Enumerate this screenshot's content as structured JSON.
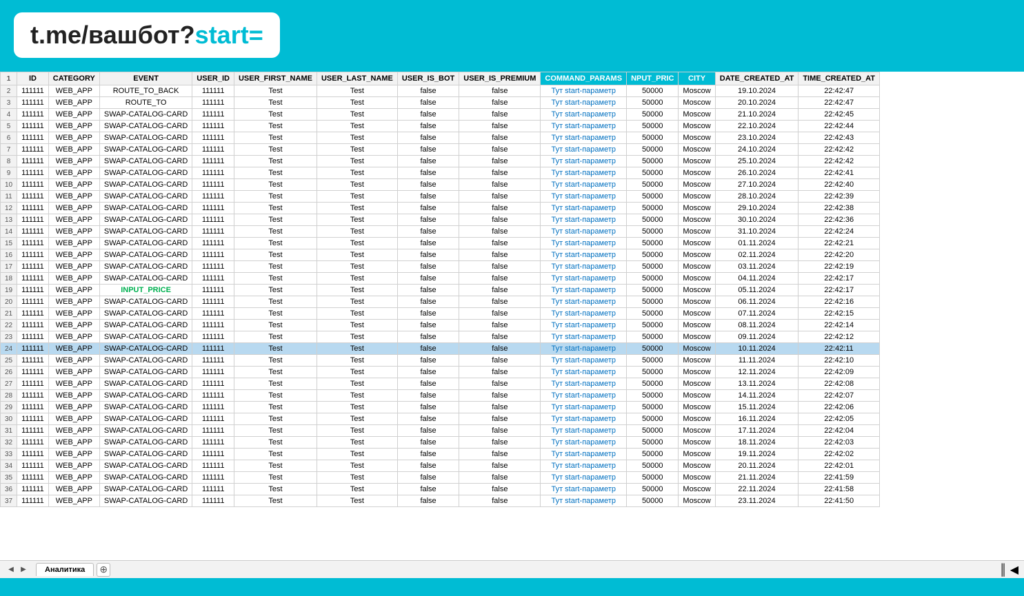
{
  "header": {
    "logo": "t.me/вашбот?start="
  },
  "table": {
    "columns": [
      {
        "key": "row_num",
        "label": "1"
      },
      {
        "key": "id",
        "label": "ID"
      },
      {
        "key": "category",
        "label": "CATEGORY"
      },
      {
        "key": "event",
        "label": "EVENT"
      },
      {
        "key": "user_id",
        "label": "USER_ID"
      },
      {
        "key": "user_first_name",
        "label": "USER_FIRST_NAME"
      },
      {
        "key": "user_last_name",
        "label": "USER_LAST_NAME"
      },
      {
        "key": "user_is_bot",
        "label": "USER_IS_BOT"
      },
      {
        "key": "user_is_premium",
        "label": "USER_IS_PREMIUM"
      },
      {
        "key": "command_params",
        "label": "COMMAND_PARAMS"
      },
      {
        "key": "input_price",
        "label": "NPUT_PRIC"
      },
      {
        "key": "city",
        "label": "CITY"
      },
      {
        "key": "date_created_at",
        "label": "DATE_CREATED_AT"
      },
      {
        "key": "time_created_at",
        "label": "TIME_CREATED_AT"
      }
    ],
    "rows": [
      {
        "row": 2,
        "id": "111111",
        "category": "WEB_APP",
        "event": "ROUTE_TO_BACK",
        "user_id": "111111",
        "fn": "Test",
        "ln": "Test",
        "bot": "false",
        "premium": "false",
        "params": "Тут start-параметр",
        "price": "50000",
        "city": "Moscow",
        "date": "19.10.2024",
        "time": "22:42:47"
      },
      {
        "row": 3,
        "id": "111111",
        "category": "WEB_APP",
        "event": "ROUTE_TO",
        "user_id": "111111",
        "fn": "Test",
        "ln": "Test",
        "bot": "false",
        "premium": "false",
        "params": "Тут start-параметр",
        "price": "50000",
        "city": "Moscow",
        "date": "20.10.2024",
        "time": "22:42:47"
      },
      {
        "row": 4,
        "id": "111111",
        "category": "WEB_APP",
        "event": "SWAP-CATALOG-CARD",
        "user_id": "111111",
        "fn": "Test",
        "ln": "Test",
        "bot": "false",
        "premium": "false",
        "params": "Тут start-параметр",
        "price": "50000",
        "city": "Moscow",
        "date": "21.10.2024",
        "time": "22:42:45"
      },
      {
        "row": 5,
        "id": "111111",
        "category": "WEB_APP",
        "event": "SWAP-CATALOG-CARD",
        "user_id": "111111",
        "fn": "Test",
        "ln": "Test",
        "bot": "false",
        "premium": "false",
        "params": "Тут start-параметр",
        "price": "50000",
        "city": "Moscow",
        "date": "22.10.2024",
        "time": "22:42:44"
      },
      {
        "row": 6,
        "id": "111111",
        "category": "WEB_APP",
        "event": "SWAP-CATALOG-CARD",
        "user_id": "111111",
        "fn": "Test",
        "ln": "Test",
        "bot": "false",
        "premium": "false",
        "params": "Тут start-параметр",
        "price": "50000",
        "city": "Moscow",
        "date": "23.10.2024",
        "time": "22:42:43"
      },
      {
        "row": 7,
        "id": "111111",
        "category": "WEB_APP",
        "event": "SWAP-CATALOG-CARD",
        "user_id": "111111",
        "fn": "Test",
        "ln": "Test",
        "bot": "false",
        "premium": "false",
        "params": "Тут start-параметр",
        "price": "50000",
        "city": "Moscow",
        "date": "24.10.2024",
        "time": "22:42:42"
      },
      {
        "row": 8,
        "id": "111111",
        "category": "WEB_APP",
        "event": "SWAP-CATALOG-CARD",
        "user_id": "111111",
        "fn": "Test",
        "ln": "Test",
        "bot": "false",
        "premium": "false",
        "params": "Тут start-параметр",
        "price": "50000",
        "city": "Moscow",
        "date": "25.10.2024",
        "time": "22:42:42"
      },
      {
        "row": 9,
        "id": "111111",
        "category": "WEB_APP",
        "event": "SWAP-CATALOG-CARD",
        "user_id": "111111",
        "fn": "Test",
        "ln": "Test",
        "bot": "false",
        "premium": "false",
        "params": "Тут start-параметр",
        "price": "50000",
        "city": "Moscow",
        "date": "26.10.2024",
        "time": "22:42:41"
      },
      {
        "row": 10,
        "id": "111111",
        "category": "WEB_APP",
        "event": "SWAP-CATALOG-CARD",
        "user_id": "111111",
        "fn": "Test",
        "ln": "Test",
        "bot": "false",
        "premium": "false",
        "params": "Тут start-параметр",
        "price": "50000",
        "city": "Moscow",
        "date": "27.10.2024",
        "time": "22:42:40"
      },
      {
        "row": 11,
        "id": "111111",
        "category": "WEB_APP",
        "event": "SWAP-CATALOG-CARD",
        "user_id": "111111",
        "fn": "Test",
        "ln": "Test",
        "bot": "false",
        "premium": "false",
        "params": "Тут start-параметр",
        "price": "50000",
        "city": "Moscow",
        "date": "28.10.2024",
        "time": "22:42:39"
      },
      {
        "row": 12,
        "id": "111111",
        "category": "WEB_APP",
        "event": "SWAP-CATALOG-CARD",
        "user_id": "111111",
        "fn": "Test",
        "ln": "Test",
        "bot": "false",
        "premium": "false",
        "params": "Тут start-параметр",
        "price": "50000",
        "city": "Moscow",
        "date": "29.10.2024",
        "time": "22:42:38"
      },
      {
        "row": 13,
        "id": "111111",
        "category": "WEB_APP",
        "event": "SWAP-CATALOG-CARD",
        "user_id": "111111",
        "fn": "Test",
        "ln": "Test",
        "bot": "false",
        "premium": "false",
        "params": "Тут start-параметр",
        "price": "50000",
        "city": "Moscow",
        "date": "30.10.2024",
        "time": "22:42:36"
      },
      {
        "row": 14,
        "id": "111111",
        "category": "WEB_APP",
        "event": "SWAP-CATALOG-CARD",
        "user_id": "111111",
        "fn": "Test",
        "ln": "Test",
        "bot": "false",
        "premium": "false",
        "params": "Тут start-параметр",
        "price": "50000",
        "city": "Moscow",
        "date": "31.10.2024",
        "time": "22:42:24"
      },
      {
        "row": 15,
        "id": "111111",
        "category": "WEB_APP",
        "event": "SWAP-CATALOG-CARD",
        "user_id": "111111",
        "fn": "Test",
        "ln": "Test",
        "bot": "false",
        "premium": "false",
        "params": "Тут start-параметр",
        "price": "50000",
        "city": "Moscow",
        "date": "01.11.2024",
        "time": "22:42:21"
      },
      {
        "row": 16,
        "id": "111111",
        "category": "WEB_APP",
        "event": "SWAP-CATALOG-CARD",
        "user_id": "111111",
        "fn": "Test",
        "ln": "Test",
        "bot": "false",
        "premium": "false",
        "params": "Тут start-параметр",
        "price": "50000",
        "city": "Moscow",
        "date": "02.11.2024",
        "time": "22:42:20"
      },
      {
        "row": 17,
        "id": "111111",
        "category": "WEB_APP",
        "event": "SWAP-CATALOG-CARD",
        "user_id": "111111",
        "fn": "Test",
        "ln": "Test",
        "bot": "false",
        "premium": "false",
        "params": "Тут start-параметр",
        "price": "50000",
        "city": "Moscow",
        "date": "03.11.2024",
        "time": "22:42:19"
      },
      {
        "row": 18,
        "id": "111111",
        "category": "WEB_APP",
        "event": "SWAP-CATALOG-CARD",
        "user_id": "111111",
        "fn": "Test",
        "ln": "Test",
        "bot": "false",
        "premium": "false",
        "params": "Тут start-параметр",
        "price": "50000",
        "city": "Moscow",
        "date": "04.11.2024",
        "time": "22:42:17"
      },
      {
        "row": 19,
        "id": "111111",
        "category": "WEB_APP",
        "event": "INPUT_PRICE",
        "user_id": "111111",
        "fn": "Test",
        "ln": "Test",
        "bot": "false",
        "premium": "false",
        "params": "Тут start-параметр",
        "price": "50000",
        "city": "Moscow",
        "date": "05.11.2024",
        "time": "22:42:17",
        "special": "input"
      },
      {
        "row": 20,
        "id": "111111",
        "category": "WEB_APP",
        "event": "SWAP-CATALOG-CARD",
        "user_id": "111111",
        "fn": "Test",
        "ln": "Test",
        "bot": "false",
        "premium": "false",
        "params": "Тут start-параметр",
        "price": "50000",
        "city": "Moscow",
        "date": "06.11.2024",
        "time": "22:42:16"
      },
      {
        "row": 21,
        "id": "111111",
        "category": "WEB_APP",
        "event": "SWAP-CATALOG-CARD",
        "user_id": "111111",
        "fn": "Test",
        "ln": "Test",
        "bot": "false",
        "premium": "false",
        "params": "Тут start-параметр",
        "price": "50000",
        "city": "Moscow",
        "date": "07.11.2024",
        "time": "22:42:15"
      },
      {
        "row": 22,
        "id": "111111",
        "category": "WEB_APP",
        "event": "SWAP-CATALOG-CARD",
        "user_id": "111111",
        "fn": "Test",
        "ln": "Test",
        "bot": "false",
        "premium": "false",
        "params": "Тут start-параметр",
        "price": "50000",
        "city": "Moscow",
        "date": "08.11.2024",
        "time": "22:42:14"
      },
      {
        "row": 23,
        "id": "111111",
        "category": "WEB_APP",
        "event": "SWAP-CATALOG-CARD",
        "user_id": "111111",
        "fn": "Test",
        "ln": "Test",
        "bot": "false",
        "premium": "false",
        "params": "Тут start-параметр",
        "price": "50000",
        "city": "Moscow",
        "date": "09.11.2024",
        "time": "22:42:12"
      },
      {
        "row": 24,
        "id": "111111",
        "category": "WEB_APP",
        "event": "SWAP-CATALOG-CARD",
        "user_id": "111111",
        "fn": "Test",
        "ln": "Test",
        "bot": "false",
        "premium": "false",
        "params": "Тут start-параметр",
        "price": "50000",
        "city": "Moscow",
        "date": "10.11.2024",
        "time": "22:42:11",
        "highlight": true
      },
      {
        "row": 25,
        "id": "111111",
        "category": "WEB_APP",
        "event": "SWAP-CATALOG-CARD",
        "user_id": "111111",
        "fn": "Test",
        "ln": "Test",
        "bot": "false",
        "premium": "false",
        "params": "Тут start-параметр",
        "price": "50000",
        "city": "Moscow",
        "date": "11.11.2024",
        "time": "22:42:10"
      },
      {
        "row": 26,
        "id": "111111",
        "category": "WEB_APP",
        "event": "SWAP-CATALOG-CARD",
        "user_id": "111111",
        "fn": "Test",
        "ln": "Test",
        "bot": "false",
        "premium": "false",
        "params": "Тут start-параметр",
        "price": "50000",
        "city": "Moscow",
        "date": "12.11.2024",
        "time": "22:42:09"
      },
      {
        "row": 27,
        "id": "111111",
        "category": "WEB_APP",
        "event": "SWAP-CATALOG-CARD",
        "user_id": "111111",
        "fn": "Test",
        "ln": "Test",
        "bot": "false",
        "premium": "false",
        "params": "Тут start-параметр",
        "price": "50000",
        "city": "Moscow",
        "date": "13.11.2024",
        "time": "22:42:08"
      },
      {
        "row": 28,
        "id": "111111",
        "category": "WEB_APP",
        "event": "SWAP-CATALOG-CARD",
        "user_id": "111111",
        "fn": "Test",
        "ln": "Test",
        "bot": "false",
        "premium": "false",
        "params": "Тут start-параметр",
        "price": "50000",
        "city": "Moscow",
        "date": "14.11.2024",
        "time": "22:42:07"
      },
      {
        "row": 29,
        "id": "111111",
        "category": "WEB_APP",
        "event": "SWAP-CATALOG-CARD",
        "user_id": "111111",
        "fn": "Test",
        "ln": "Test",
        "bot": "false",
        "premium": "false",
        "params": "Тут start-параметр",
        "price": "50000",
        "city": "Moscow",
        "date": "15.11.2024",
        "time": "22:42:06"
      },
      {
        "row": 30,
        "id": "111111",
        "category": "WEB_APP",
        "event": "SWAP-CATALOG-CARD",
        "user_id": "111111",
        "fn": "Test",
        "ln": "Test",
        "bot": "false",
        "premium": "false",
        "params": "Тут start-параметр",
        "price": "50000",
        "city": "Moscow",
        "date": "16.11.2024",
        "time": "22:42:05"
      },
      {
        "row": 31,
        "id": "111111",
        "category": "WEB_APP",
        "event": "SWAP-CATALOG-CARD",
        "user_id": "111111",
        "fn": "Test",
        "ln": "Test",
        "bot": "false",
        "premium": "false",
        "params": "Тут start-параметр",
        "price": "50000",
        "city": "Moscow",
        "date": "17.11.2024",
        "time": "22:42:04"
      },
      {
        "row": 32,
        "id": "111111",
        "category": "WEB_APP",
        "event": "SWAP-CATALOG-CARD",
        "user_id": "111111",
        "fn": "Test",
        "ln": "Test",
        "bot": "false",
        "premium": "false",
        "params": "Тут start-параметр",
        "price": "50000",
        "city": "Moscow",
        "date": "18.11.2024",
        "time": "22:42:03"
      },
      {
        "row": 33,
        "id": "111111",
        "category": "WEB_APP",
        "event": "SWAP-CATALOG-CARD",
        "user_id": "111111",
        "fn": "Test",
        "ln": "Test",
        "bot": "false",
        "premium": "false",
        "params": "Тут start-параметр",
        "price": "50000",
        "city": "Moscow",
        "date": "19.11.2024",
        "time": "22:42:02"
      },
      {
        "row": 34,
        "id": "111111",
        "category": "WEB_APP",
        "event": "SWAP-CATALOG-CARD",
        "user_id": "111111",
        "fn": "Test",
        "ln": "Test",
        "bot": "false",
        "premium": "false",
        "params": "Тут start-параметр",
        "price": "50000",
        "city": "Moscow",
        "date": "20.11.2024",
        "time": "22:42:01"
      },
      {
        "row": 35,
        "id": "111111",
        "category": "WEB_APP",
        "event": "SWAP-CATALOG-CARD",
        "user_id": "111111",
        "fn": "Test",
        "ln": "Test",
        "bot": "false",
        "premium": "false",
        "params": "Тут start-параметр",
        "price": "50000",
        "city": "Moscow",
        "date": "21.11.2024",
        "time": "22:41:59"
      },
      {
        "row": 36,
        "id": "111111",
        "category": "WEB_APP",
        "event": "SWAP-CATALOG-CARD",
        "user_id": "111111",
        "fn": "Test",
        "ln": "Test",
        "bot": "false",
        "premium": "false",
        "params": "Тут start-параметр",
        "price": "50000",
        "city": "Moscow",
        "date": "22.11.2024",
        "time": "22:41:58"
      },
      {
        "row": 37,
        "id": "111111",
        "category": "WEB_APP",
        "event": "SWAP-CATALOG-CARD",
        "user_id": "111111",
        "fn": "Test",
        "ln": "Test",
        "bot": "false",
        "premium": "false",
        "params": "Тут start-параметр",
        "price": "50000",
        "city": "Moscow",
        "date": "23.11.2024",
        "time": "22:41:50"
      }
    ],
    "sheet_tab": "Аналитика",
    "scroll_indicator": "I ◄"
  }
}
